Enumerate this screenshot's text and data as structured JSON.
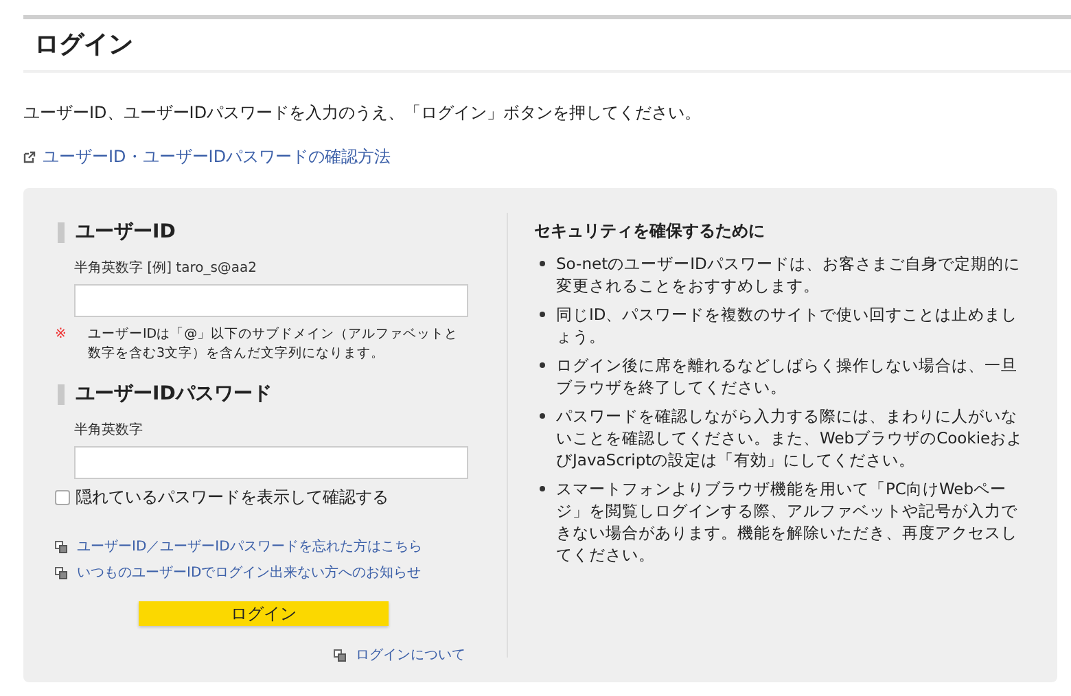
{
  "page_title": "ログイン",
  "intro": "ユーザーID、ユーザーIDパスワードを入力のうえ、「ログイン」ボタンを押してください。",
  "help_link": "ユーザーID・ユーザーIDパスワードの確認方法",
  "form": {
    "user_id": {
      "heading": "ユーザーID",
      "hint": "半角英数字 [例] taro_s@aa2",
      "note_mark": "※",
      "note": "ユーザーIDは「@」以下のサブドメイン（アルファベットと数字を含む3文字）を含んだ文字列になります。"
    },
    "password": {
      "heading": "ユーザーIDパスワード",
      "hint": "半角英数字"
    },
    "show_password": {
      "label": "隠れているパスワードを表示して確認する",
      "checked": false
    },
    "links": [
      "ユーザーID／ユーザーIDパスワードを忘れた方はこちら",
      "いつものユーザーIDでログイン出来ない方へのお知らせ"
    ],
    "submit": "ログイン",
    "about_link": "ログインについて"
  },
  "security": {
    "heading": "セキュリティを確保するために",
    "items": [
      "So-netのユーザーIDパスワードは、お客さまご自身で定期的に変更されることをおすすめします。",
      "同じID、パスワードを複数のサイトで使い回すことは止めましょう。",
      "ログイン後に席を離れるなどしばらく操作しない場合は、一旦ブラウザを終了してください。",
      "パスワードを確認しながら入力する際には、まわりに人がいないことを確認してください。また、WebブラウザのCookieおよびJavaScriptの設定は「有効」にしてください。",
      "スマートフォンよりブラウザ機能を用いて「PC向けWebページ」を閲覧しログインする際、アルファベットや記号が入力できない場合があります。機能を解除いただき、再度アクセスしてください。"
    ]
  }
}
